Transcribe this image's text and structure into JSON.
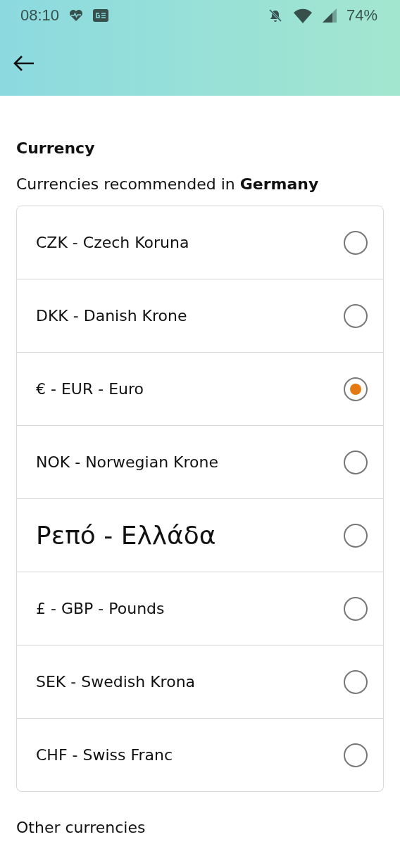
{
  "status_bar": {
    "time": "08:10",
    "battery": "74%"
  },
  "section": {
    "title": "Currency",
    "subtitle": "Currencies recommended in **Germany**"
  },
  "currencies": [
    {
      "label": "CZK - Czech Koruna",
      "selected": false,
      "kind": "normal"
    },
    {
      "label": "DKK - Danish Krone",
      "selected": false,
      "kind": "normal"
    },
    {
      "label": "€ - EUR - Euro",
      "selected": true,
      "kind": "normal"
    },
    {
      "label": "NOK - Norwegian Krone",
      "selected": false,
      "kind": "normal"
    },
    {
      "label": "Ρεπό - Ελλάδα",
      "selected": false,
      "kind": "large"
    },
    {
      "label": "£ - GBP - Pounds",
      "selected": false,
      "kind": "normal"
    },
    {
      "label": "SEK - Swedish Krona",
      "selected": false,
      "kind": "normal"
    },
    {
      "label": "CHF - Swiss Franc",
      "selected": false,
      "kind": "normal"
    }
  ],
  "other_title": "Other currencies"
}
